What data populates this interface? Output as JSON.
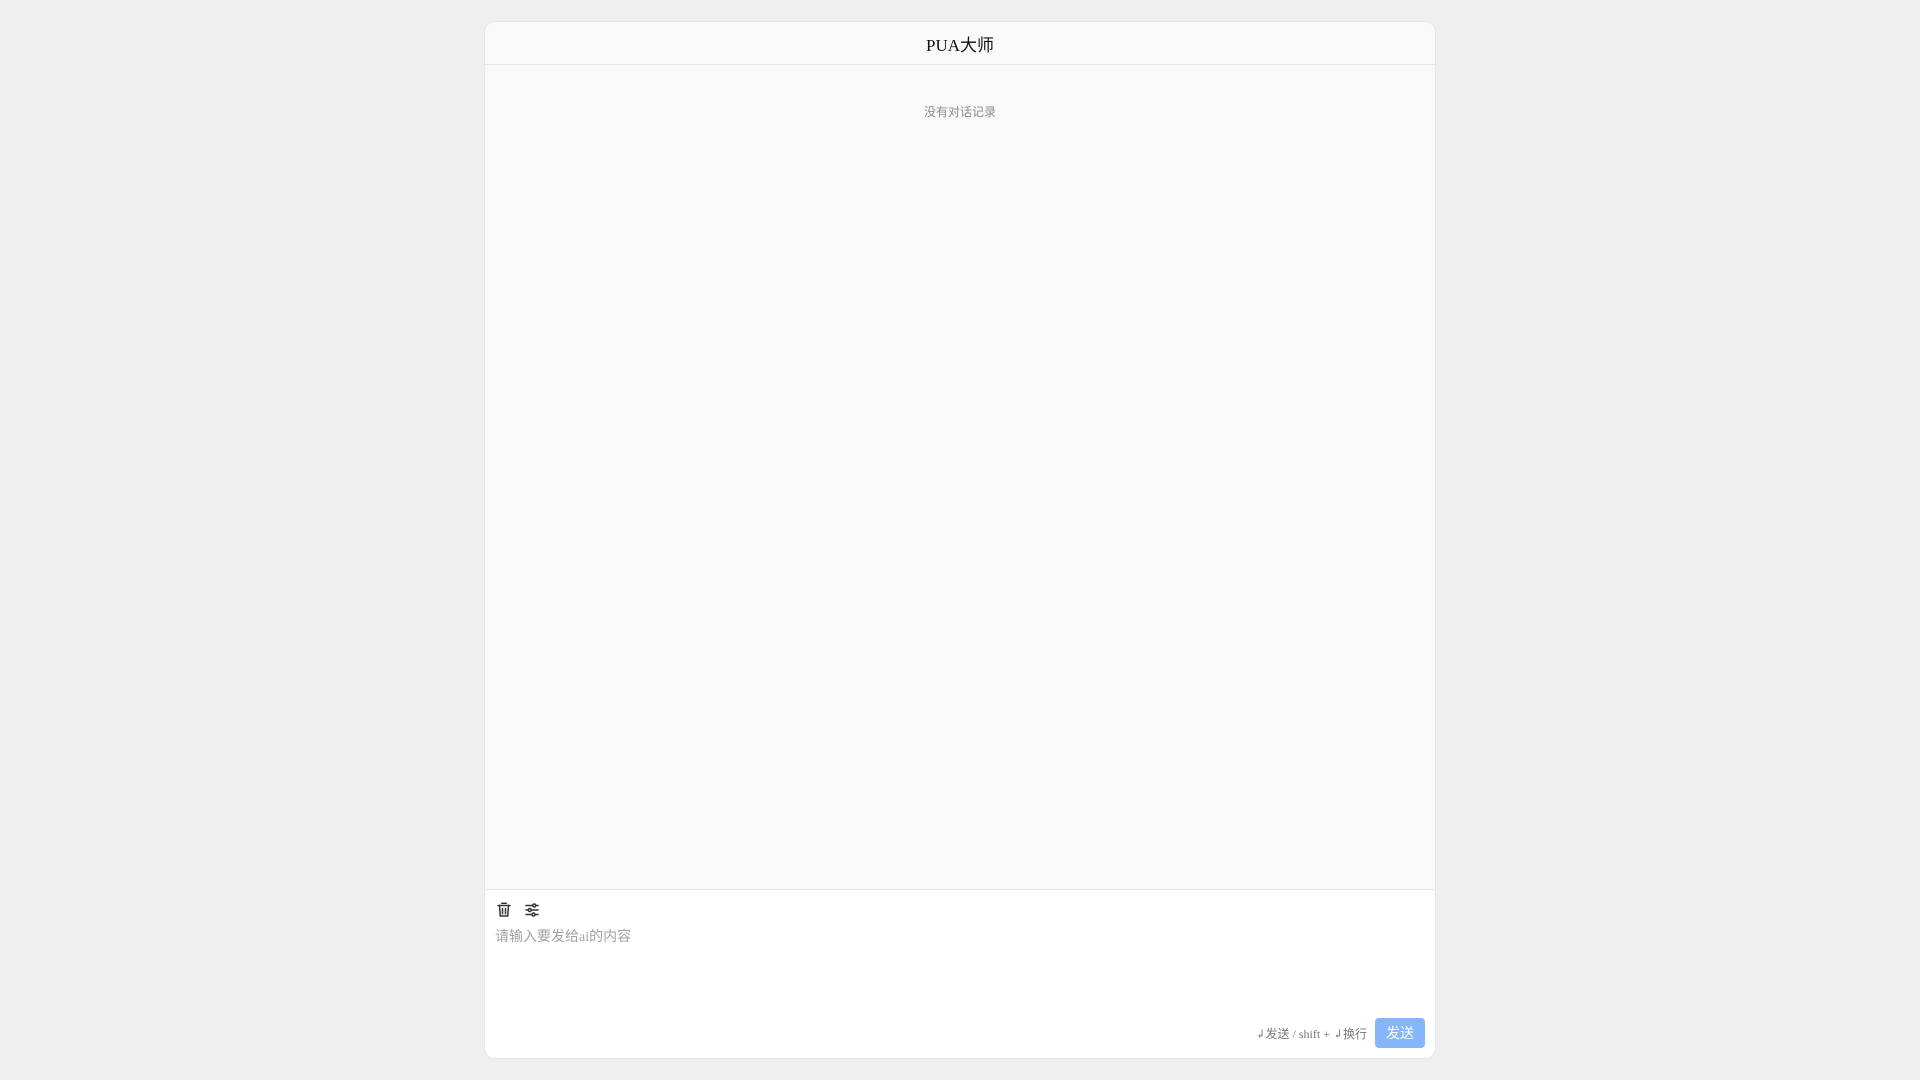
{
  "app": {
    "title": "PUA大师"
  },
  "messages": {
    "empty_text": "没有对话记录"
  },
  "composer": {
    "icons": {
      "clear": "trash-icon",
      "settings": "sliders-icon"
    },
    "placeholder": "请输入要发给ai的内容",
    "value": "",
    "hint_text": "↲发送 / shift + ↲换行",
    "send_label": "发送"
  },
  "colors": {
    "page_background": "#efefef",
    "panel_background": "#f9f9f9",
    "composer_background": "#ffffff",
    "send_button": "#85b5fb",
    "muted_text": "#8c8c8c"
  }
}
